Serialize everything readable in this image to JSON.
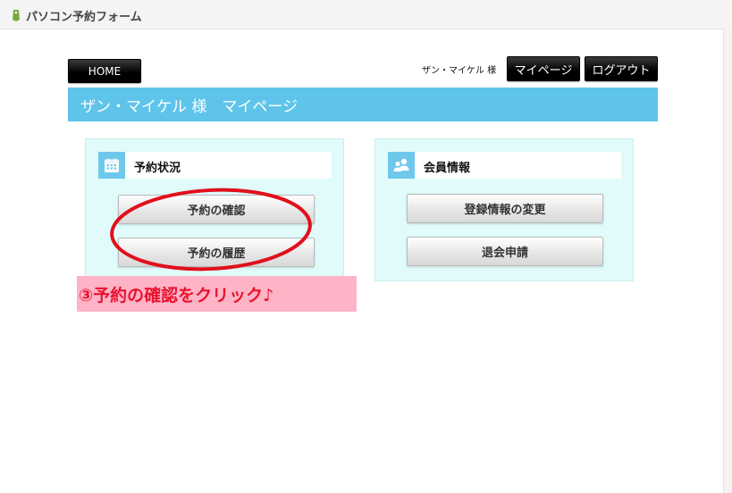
{
  "app": {
    "title": "パソコン予約フォーム",
    "logo_icon": "leaf-tag-icon"
  },
  "nav": {
    "home_label": "HOME",
    "mypage_label": "マイページ",
    "logout_label": "ログアウト"
  },
  "user": {
    "name_label": "ザン・マイケル 様"
  },
  "header": {
    "title": "ザン・マイケル 様　マイページ"
  },
  "panels": {
    "reservation": {
      "title": "予約状況",
      "icon": "calendar-icon",
      "buttons": [
        "予約の確認",
        "予約の履歴"
      ]
    },
    "member": {
      "title": "会員情報",
      "icon": "users-icon",
      "buttons": [
        "登録情報の変更",
        "退会申請"
      ]
    }
  },
  "annotation": {
    "text": "③予約の確認をクリック♪"
  },
  "colors": {
    "header_bg": "#5fc4ea",
    "panel_bg": "#e1fbfb",
    "callout_bg": "#ffb3c6",
    "callout_text": "#e8132f",
    "annotation_stroke": "#e0101c"
  }
}
